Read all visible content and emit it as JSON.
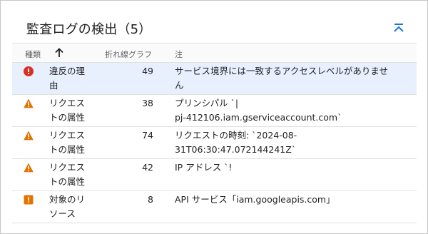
{
  "panel": {
    "title": "監査ログの検出（5）",
    "collapse_icon": "collapse-up-icon"
  },
  "table": {
    "headers": {
      "type": "種類",
      "sort_icon": "arrow-up-icon",
      "line_graph": "折れ線グラフ",
      "note": "注"
    },
    "rows": [
      {
        "severity": "error",
        "icon": "error-circle-icon",
        "type": [
          "違反の理",
          "由"
        ],
        "line_graph": "49",
        "note": [
          "サービス境界には一致するアクセスレベルがありませ",
          "ん"
        ],
        "selected": true
      },
      {
        "severity": "warning",
        "icon": "warning-triangle-icon",
        "type": [
          "リクエス",
          "トの属性"
        ],
        "line_graph": "38",
        "note": [
          "プリンシパル `|",
          "pj-412106.iam.gserviceaccount.com`"
        ],
        "selected": false
      },
      {
        "severity": "warning",
        "icon": "warning-triangle-icon",
        "type": [
          "リクエス",
          "トの属性"
        ],
        "line_graph": "74",
        "note": [
          "リクエストの時刻: `2024-08-",
          "31T06:30:47.072144241Z`"
        ],
        "selected": false
      },
      {
        "severity": "warning",
        "icon": "warning-triangle-icon",
        "type": [
          "リクエス",
          "トの属性"
        ],
        "line_graph": "42",
        "note": [
          "IP アドレス `!",
          ""
        ],
        "selected": false
      },
      {
        "severity": "warning",
        "icon": "warning-square-icon",
        "type": [
          "対象のリ",
          "ソース"
        ],
        "line_graph": "8",
        "note": [
          "API サービス「iam.googleapis.com」",
          ""
        ],
        "selected": false
      }
    ]
  },
  "colors": {
    "error": "#d93025",
    "warning": "#e37400",
    "accent": "#1a73e8",
    "selected_row": "#e8f0fe"
  }
}
